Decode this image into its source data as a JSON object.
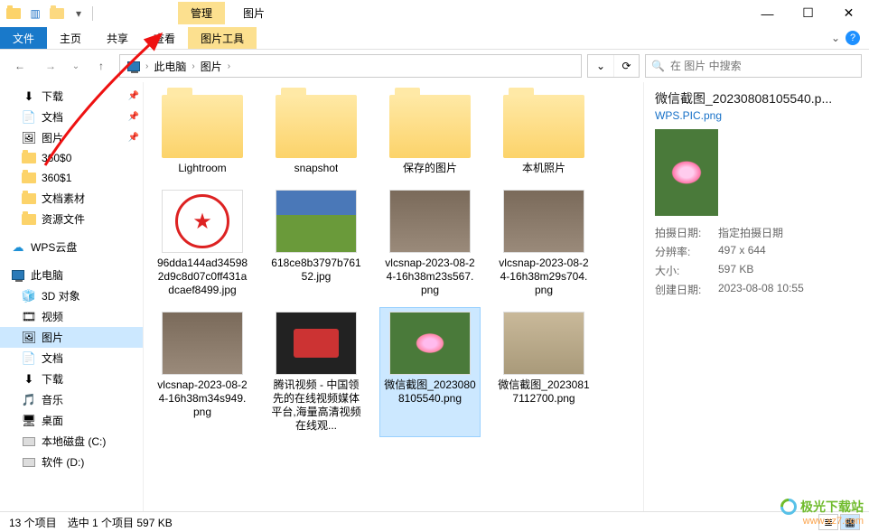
{
  "window": {
    "context_tab": "管理",
    "title": "图片",
    "minimize": "—",
    "maximize": "☐",
    "close": "✕"
  },
  "ribbon": {
    "file": "文件",
    "home": "主页",
    "share": "共享",
    "view": "查看",
    "picture_tools": "图片工具",
    "help_icon": "?",
    "expand_icon": "⌄"
  },
  "address": {
    "back_icon": "←",
    "forward_icon": "→",
    "recent_icon": "⌄",
    "up_icon": "↑",
    "segments": [
      "此电脑",
      "图片"
    ],
    "dropdown_icon": "⌄",
    "refresh_icon": "⟳",
    "search_placeholder": "在 图片 中搜索",
    "search_icon": "🔍"
  },
  "nav": {
    "quick": [
      {
        "icon": "⬇",
        "label": "下载",
        "pinned": true
      },
      {
        "icon": "📄",
        "label": "文档",
        "pinned": true
      },
      {
        "icon": "🖼",
        "label": "图片",
        "pinned": true
      },
      {
        "icon": "📁",
        "label": "360$0"
      },
      {
        "icon": "📁",
        "label": "360$1"
      },
      {
        "icon": "📁",
        "label": "文档素材"
      },
      {
        "icon": "📁",
        "label": "资源文件"
      }
    ],
    "cloud": {
      "icon": "☁",
      "label": "WPS云盘"
    },
    "thispc": {
      "icon": "pc",
      "label": "此电脑"
    },
    "pc_items": [
      {
        "icon": "🧊",
        "label": "3D 对象"
      },
      {
        "icon": "🎞",
        "label": "视频"
      },
      {
        "icon": "🖼",
        "label": "图片",
        "selected": true
      },
      {
        "icon": "📄",
        "label": "文档"
      },
      {
        "icon": "⬇",
        "label": "下载"
      },
      {
        "icon": "🎵",
        "label": "音乐"
      },
      {
        "icon": "🖥",
        "label": "桌面"
      },
      {
        "icon": "disk",
        "label": "本地磁盘 (C:)"
      },
      {
        "icon": "disk",
        "label": "软件 (D:)"
      }
    ]
  },
  "items": [
    {
      "type": "folder",
      "label": "Lightroom"
    },
    {
      "type": "folder",
      "label": "snapshot"
    },
    {
      "type": "folder",
      "label": "保存的图片"
    },
    {
      "type": "folder",
      "label": "本机照片"
    },
    {
      "type": "stamp",
      "label": "96dda144ad345982d9c8d07c0ff431adcaef8499.jpg"
    },
    {
      "type": "tulip",
      "label": "618ce8b3797b76152.jpg"
    },
    {
      "type": "room",
      "label": "vlcsnap-2023-08-24-16h38m23s567.png"
    },
    {
      "type": "room",
      "label": "vlcsnap-2023-08-24-16h38m29s704.png"
    },
    {
      "type": "room",
      "label": "vlcsnap-2023-08-24-16h38m34s949.png"
    },
    {
      "type": "tv",
      "label": "腾讯视频 - 中国领先的在线视频媒体平台,海量高清视频在线观..."
    },
    {
      "type": "lotus",
      "label": "微信截图_20230808105540.png",
      "selected": true
    },
    {
      "type": "portrait",
      "label": "微信截图_20230817112700.png"
    }
  ],
  "details": {
    "title": "微信截图_20230808105540.p...",
    "subtitle": "WPS.PIC.png",
    "props": [
      {
        "key": "拍摄日期:",
        "val": "指定拍摄日期"
      },
      {
        "key": "分辨率:",
        "val": "497 x 644"
      },
      {
        "key": "大小:",
        "val": "597 KB"
      },
      {
        "key": "创建日期:",
        "val": "2023-08-08 10:55"
      }
    ]
  },
  "status": {
    "count": "13 个项目",
    "selection": "选中 1 个项目  597 KB"
  },
  "watermark": {
    "l1": "极光下载站",
    "l2": "www.xz7.com"
  }
}
